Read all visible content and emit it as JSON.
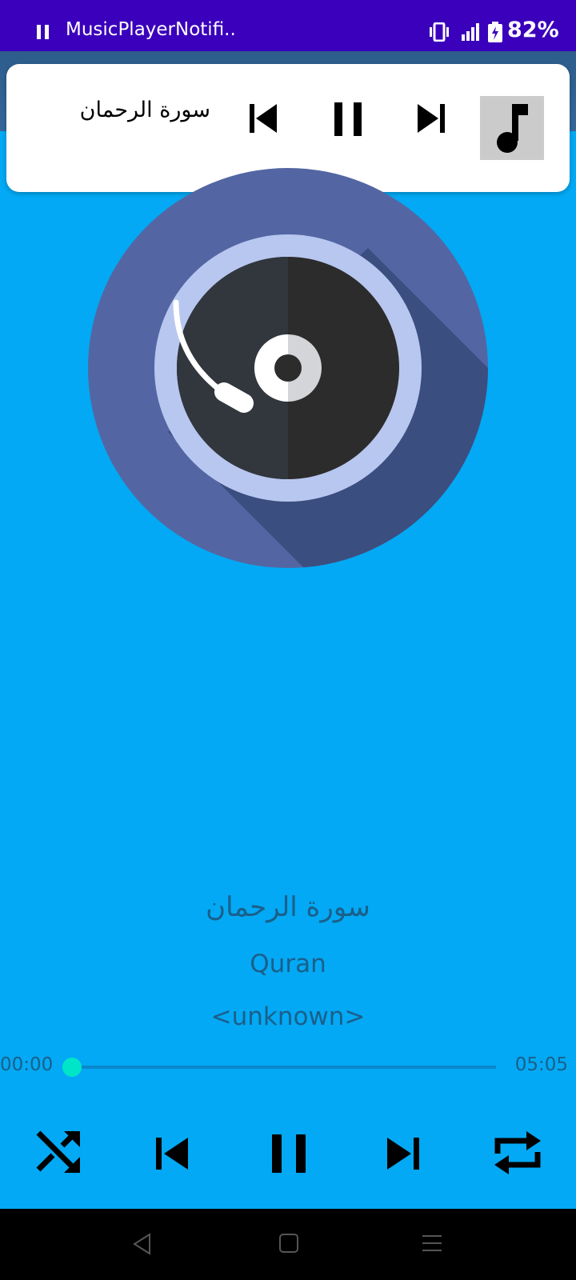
{
  "status_bar": {
    "app_name": "MusicPlayerNotifi..",
    "battery_percent": "82%",
    "icons": [
      "pause-icon",
      "vibrate-icon",
      "signal-icon",
      "battery-charging-icon"
    ]
  },
  "notification": {
    "title": "سورة الرحمان",
    "buttons": [
      "previous-icon",
      "pause-icon",
      "next-icon"
    ],
    "thumbnail_icon": "music-note-icon"
  },
  "player": {
    "title": "سورة الرحمان",
    "album": "Quran",
    "artist": "<unknown>",
    "current_time": "00:00",
    "total_time": "05:05",
    "progress": 0.0,
    "controls": [
      "shuffle-icon",
      "previous-icon",
      "pause-icon",
      "next-icon",
      "repeat-icon"
    ]
  },
  "colors": {
    "background": "#03A9F4",
    "status_bar": "#3A00BB",
    "seek_thumb": "#00E5C8",
    "vinyl_outer": "#5366A3"
  },
  "nav_bar": {
    "icons": [
      "back-icon",
      "home-icon",
      "menu-icon"
    ]
  }
}
